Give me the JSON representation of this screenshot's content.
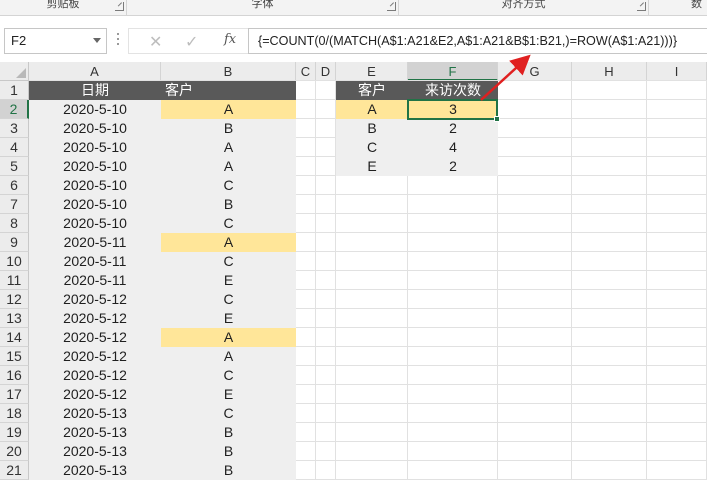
{
  "ribbon": {
    "groups": [
      {
        "label": "剪贴板"
      },
      {
        "label": "字体"
      },
      {
        "label": "对齐方式"
      },
      {
        "label": "数"
      }
    ]
  },
  "formula_bar": {
    "name_box": "F2",
    "cancel_icon": "✕",
    "enter_icon": "✓",
    "fx_label": "fx",
    "formula": "{=COUNT(0/(MATCH(A$1:A21&E2,A$1:A21&B$1:B21,)=ROW(A$1:A21)))}"
  },
  "columns": [
    "A",
    "B",
    "C",
    "D",
    "E",
    "F",
    "G",
    "H",
    "I"
  ],
  "selected_column": "F",
  "selected_row": 2,
  "rows": [
    "1",
    "2",
    "3",
    "4",
    "5",
    "6",
    "7",
    "8",
    "9",
    "10",
    "11",
    "12",
    "13",
    "14",
    "15",
    "16",
    "17",
    "18",
    "19",
    "20",
    "21"
  ],
  "table1": {
    "headers": [
      "日期",
      "客户"
    ],
    "rows": [
      {
        "date": "2020-5-10",
        "customer": "A",
        "highlight": true
      },
      {
        "date": "2020-5-10",
        "customer": "B",
        "highlight": false
      },
      {
        "date": "2020-5-10",
        "customer": "A",
        "highlight": false
      },
      {
        "date": "2020-5-10",
        "customer": "A",
        "highlight": false
      },
      {
        "date": "2020-5-10",
        "customer": "C",
        "highlight": false
      },
      {
        "date": "2020-5-10",
        "customer": "B",
        "highlight": false
      },
      {
        "date": "2020-5-10",
        "customer": "C",
        "highlight": false
      },
      {
        "date": "2020-5-11",
        "customer": "A",
        "highlight": true
      },
      {
        "date": "2020-5-11",
        "customer": "C",
        "highlight": false
      },
      {
        "date": "2020-5-11",
        "customer": "E",
        "highlight": false
      },
      {
        "date": "2020-5-12",
        "customer": "C",
        "highlight": false
      },
      {
        "date": "2020-5-12",
        "customer": "E",
        "highlight": false
      },
      {
        "date": "2020-5-12",
        "customer": "A",
        "highlight": true
      },
      {
        "date": "2020-5-12",
        "customer": "A",
        "highlight": false
      },
      {
        "date": "2020-5-12",
        "customer": "C",
        "highlight": false
      },
      {
        "date": "2020-5-12",
        "customer": "E",
        "highlight": false
      },
      {
        "date": "2020-5-13",
        "customer": "C",
        "highlight": false
      },
      {
        "date": "2020-5-13",
        "customer": "B",
        "highlight": false
      },
      {
        "date": "2020-5-13",
        "customer": "B",
        "highlight": false
      },
      {
        "date": "2020-5-13",
        "customer": "B",
        "highlight": false
      }
    ]
  },
  "table2": {
    "headers": [
      "客户",
      "来访次数"
    ],
    "rows": [
      {
        "customer": "A",
        "count": "3"
      },
      {
        "customer": "B",
        "count": "2"
      },
      {
        "customer": "C",
        "count": "4"
      },
      {
        "customer": "E",
        "count": "2"
      }
    ]
  },
  "colors": {
    "header_fill": "#595959",
    "highlight": "#ffe699",
    "table_fill": "#efefef",
    "selection": "#217346",
    "arrow": "#e02020"
  }
}
